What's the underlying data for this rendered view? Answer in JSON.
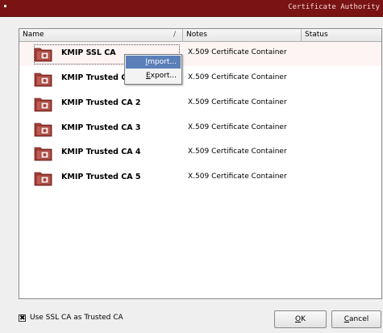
{
  "window": {
    "title": "Certificate Authority"
  },
  "table": {
    "columns": {
      "name": "Name",
      "notes": "Notes",
      "status": "Status"
    },
    "sort_indicator": "/",
    "rows": [
      {
        "name": "KMIP SSL CA",
        "notes": "X.509 Certificate Container",
        "status": ""
      },
      {
        "name": "KMIP Trusted CA",
        "notes": "X.509 Certificate Container",
        "status": ""
      },
      {
        "name": "KMIP Trusted CA 2",
        "notes": "X.509 Certificate Container",
        "status": ""
      },
      {
        "name": "KMIP Trusted CA 3",
        "notes": "X.509 Certificate Container",
        "status": ""
      },
      {
        "name": "KMIP Trusted CA 4",
        "notes": "X.509 Certificate Container",
        "status": ""
      },
      {
        "name": "KMIP Trusted CA 5",
        "notes": "X.509 Certificate Container",
        "status": ""
      }
    ]
  },
  "context_menu": {
    "import": {
      "mnemonic": "I",
      "rest": "mport..."
    },
    "export": {
      "mnemonic": "E",
      "rest": "xport..."
    }
  },
  "footer": {
    "checkbox_label": "Use SSL CA as Trusted CA",
    "checkbox_mark": "✖",
    "checked": true,
    "ok": {
      "mnemonic": "O",
      "rest": "K"
    },
    "cancel": {
      "mnemonic": "C",
      "rest": "ancel"
    }
  },
  "icons": {
    "row_icon": "certificate-folder-icon",
    "accent": "#7a1414",
    "icon_color": "#a8403a"
  }
}
